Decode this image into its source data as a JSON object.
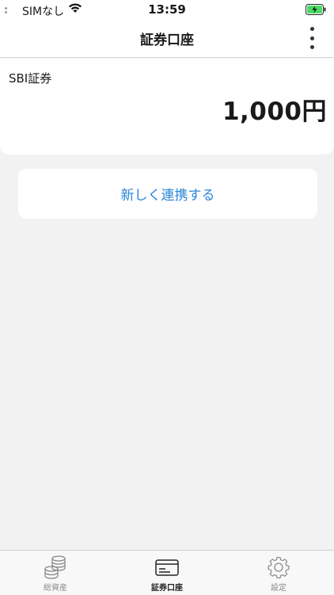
{
  "status_bar": {
    "carrier": "SIMなし",
    "time": "13:59"
  },
  "nav": {
    "title": "証券口座"
  },
  "account": {
    "name": "SBI証券",
    "balance": "1,000円"
  },
  "link_button": {
    "label": "新しく連携する"
  },
  "tabs": [
    {
      "label": "総資産",
      "icon": "coins-stack-icon",
      "active": false
    },
    {
      "label": "証券口座",
      "icon": "card-icon",
      "active": true
    },
    {
      "label": "設定",
      "icon": "gear-icon",
      "active": false
    }
  ],
  "colors": {
    "accent": "#2a86d8",
    "background": "#f2f2f2",
    "battery": "#4cd964"
  }
}
